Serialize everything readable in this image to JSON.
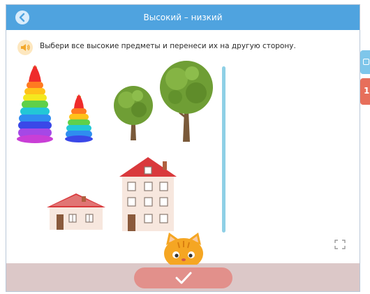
{
  "header": {
    "title": "Высокий – низкий"
  },
  "task": {
    "instruction": "Выбери все высокие предметы и перенеси их на другую сторону."
  },
  "items": [
    {
      "name": "tall-pyramid",
      "kind": "pyramid"
    },
    {
      "name": "short-pyramid",
      "kind": "pyramid"
    },
    {
      "name": "short-tree",
      "kind": "tree"
    },
    {
      "name": "tall-tree",
      "kind": "tree"
    },
    {
      "name": "low-house",
      "kind": "house"
    },
    {
      "name": "tall-house",
      "kind": "house"
    }
  ],
  "side_panel": {
    "badge": "1"
  },
  "icons": {
    "back": "back-arrow-icon",
    "sound": "speaker-icon",
    "check": "checkmark-icon",
    "expand": "fullscreen-icon"
  },
  "colors": {
    "header": "#4fa3df",
    "check_button": "#e2908b",
    "bottom_bar": "#dcc8c8",
    "divider": "#8fd0e6"
  }
}
